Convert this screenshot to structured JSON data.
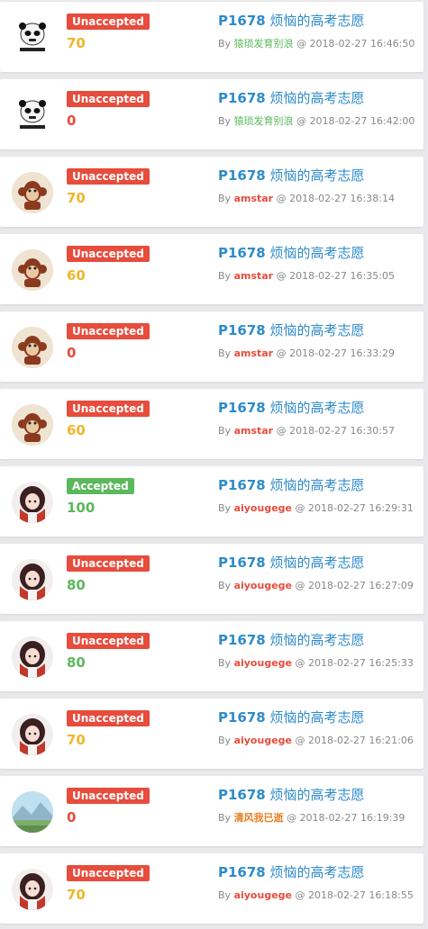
{
  "colors": {
    "accepted": "#5cb85c",
    "unaccepted": "#e74c3c",
    "score_full": "#5cb85c",
    "score_partial": "#f0b62a",
    "score_mid": "#5cb85c",
    "score_zero": "#e74c3c",
    "problem_link": "#2e8bc9",
    "meta_text": "#888888"
  },
  "labels": {
    "by": "By",
    "at": "@"
  },
  "records": [
    {
      "status": "Unaccepted",
      "score": "70",
      "score_color": "#f0b62a",
      "problem_id": "P1678",
      "problem_title": "烦恼的高考志愿",
      "user": "猿琐发育别浪",
      "user_color": "#5cb85c",
      "user_bold": false,
      "time": "2018-02-27 16:46:50",
      "avatar": "panda-meme-avatar"
    },
    {
      "status": "Unaccepted",
      "score": "0",
      "score_color": "#e74c3c",
      "problem_id": "P1678",
      "problem_title": "烦恼的高考志愿",
      "user": "猿琐发育别浪",
      "user_color": "#5cb85c",
      "user_bold": false,
      "time": "2018-02-27 16:42:00",
      "avatar": "panda-meme-avatar"
    },
    {
      "status": "Unaccepted",
      "score": "70",
      "score_color": "#f0b62a",
      "problem_id": "P1678",
      "problem_title": "烦恼的高考志愿",
      "user": "amstar",
      "user_color": "#e74c3c",
      "user_bold": true,
      "time": "2018-02-27 16:38:14",
      "avatar": "monkey-avatar"
    },
    {
      "status": "Unaccepted",
      "score": "60",
      "score_color": "#f0b62a",
      "problem_id": "P1678",
      "problem_title": "烦恼的高考志愿",
      "user": "amstar",
      "user_color": "#e74c3c",
      "user_bold": true,
      "time": "2018-02-27 16:35:05",
      "avatar": "monkey-avatar"
    },
    {
      "status": "Unaccepted",
      "score": "0",
      "score_color": "#e74c3c",
      "problem_id": "P1678",
      "problem_title": "烦恼的高考志愿",
      "user": "amstar",
      "user_color": "#e74c3c",
      "user_bold": true,
      "time": "2018-02-27 16:33:29",
      "avatar": "monkey-avatar"
    },
    {
      "status": "Unaccepted",
      "score": "60",
      "score_color": "#f0b62a",
      "problem_id": "P1678",
      "problem_title": "烦恼的高考志愿",
      "user": "amstar",
      "user_color": "#e74c3c",
      "user_bold": true,
      "time": "2018-02-27 16:30:57",
      "avatar": "monkey-avatar"
    },
    {
      "status": "Accepted",
      "score": "100",
      "score_color": "#5cb85c",
      "problem_id": "P1678",
      "problem_title": "烦恼的高考志愿",
      "user": "aiyougege",
      "user_color": "#e74c3c",
      "user_bold": true,
      "time": "2018-02-27 16:29:31",
      "avatar": "anime-girl-avatar"
    },
    {
      "status": "Unaccepted",
      "score": "80",
      "score_color": "#5cb85c",
      "problem_id": "P1678",
      "problem_title": "烦恼的高考志愿",
      "user": "aiyougege",
      "user_color": "#e74c3c",
      "user_bold": true,
      "time": "2018-02-27 16:27:09",
      "avatar": "anime-girl-avatar"
    },
    {
      "status": "Unaccepted",
      "score": "80",
      "score_color": "#5cb85c",
      "problem_id": "P1678",
      "problem_title": "烦恼的高考志愿",
      "user": "aiyougege",
      "user_color": "#e74c3c",
      "user_bold": true,
      "time": "2018-02-27 16:25:33",
      "avatar": "anime-girl-avatar"
    },
    {
      "status": "Unaccepted",
      "score": "70",
      "score_color": "#f0b62a",
      "problem_id": "P1678",
      "problem_title": "烦恼的高考志愿",
      "user": "aiyougege",
      "user_color": "#e74c3c",
      "user_bold": true,
      "time": "2018-02-27 16:21:06",
      "avatar": "anime-girl-avatar"
    },
    {
      "status": "Unaccepted",
      "score": "0",
      "score_color": "#e74c3c",
      "problem_id": "P1678",
      "problem_title": "烦恼的高考志愿",
      "user": "清风我已逝",
      "user_color": "#e67e22",
      "user_bold": true,
      "time": "2018-02-27 16:19:39",
      "avatar": "landscape-avatar"
    },
    {
      "status": "Unaccepted",
      "score": "70",
      "score_color": "#f0b62a",
      "problem_id": "P1678",
      "problem_title": "烦恼的高考志愿",
      "user": "aiyougege",
      "user_color": "#e74c3c",
      "user_bold": true,
      "time": "2018-02-27 16:18:55",
      "avatar": "anime-girl-avatar"
    }
  ]
}
